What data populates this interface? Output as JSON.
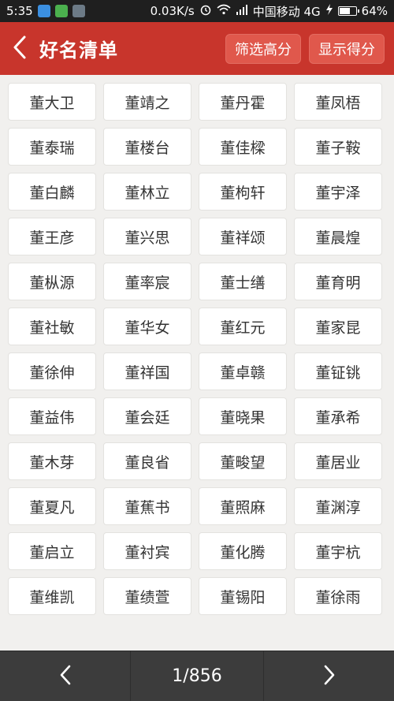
{
  "status_bar": {
    "time": "5:35",
    "network_speed": "0.03K/s",
    "carrier": "中国移动 4G",
    "battery": "64%",
    "battery_level": 0.64
  },
  "header": {
    "title": "好名清单",
    "filter_button": "筛选高分",
    "score_button": "显示得分",
    "back_icon": "chevron-left-icon"
  },
  "names": [
    "董大卫",
    "董靖之",
    "董丹霍",
    "董凤梧",
    "董泰瑞",
    "董楼台",
    "董佳樑",
    "董子鞍",
    "董白麟",
    "董林立",
    "董枸轩",
    "董宇泽",
    "董王彦",
    "董兴思",
    "董祥颂",
    "董晨煌",
    "董枞源",
    "董率宸",
    "董士缮",
    "董育明",
    "董社敏",
    "董华女",
    "董红元",
    "董家昆",
    "董徐伸",
    "董祥国",
    "董卓赣",
    "董钲铫",
    "董益伟",
    "董会廷",
    "董晓果",
    "董承希",
    "董木芽",
    "董良省",
    "董畯望",
    "董居业",
    "董夏凡",
    "董蕉书",
    "董照麻",
    "董渊淳",
    "董启立",
    "董衬宾",
    "董化腾",
    "董宇杭",
    "董维凯",
    "董绩萱",
    "董锡阳",
    "董徐雨"
  ],
  "pagination": {
    "page_text": "1/856",
    "prev_icon": "chevron-left-icon",
    "next_icon": "chevron-right-icon"
  },
  "colors": {
    "header_bg": "#c8352c",
    "header_button_bg": "#e0584c",
    "page_bg": "#f1f0ee",
    "bottom_bar_bg": "#3c3c3c"
  }
}
